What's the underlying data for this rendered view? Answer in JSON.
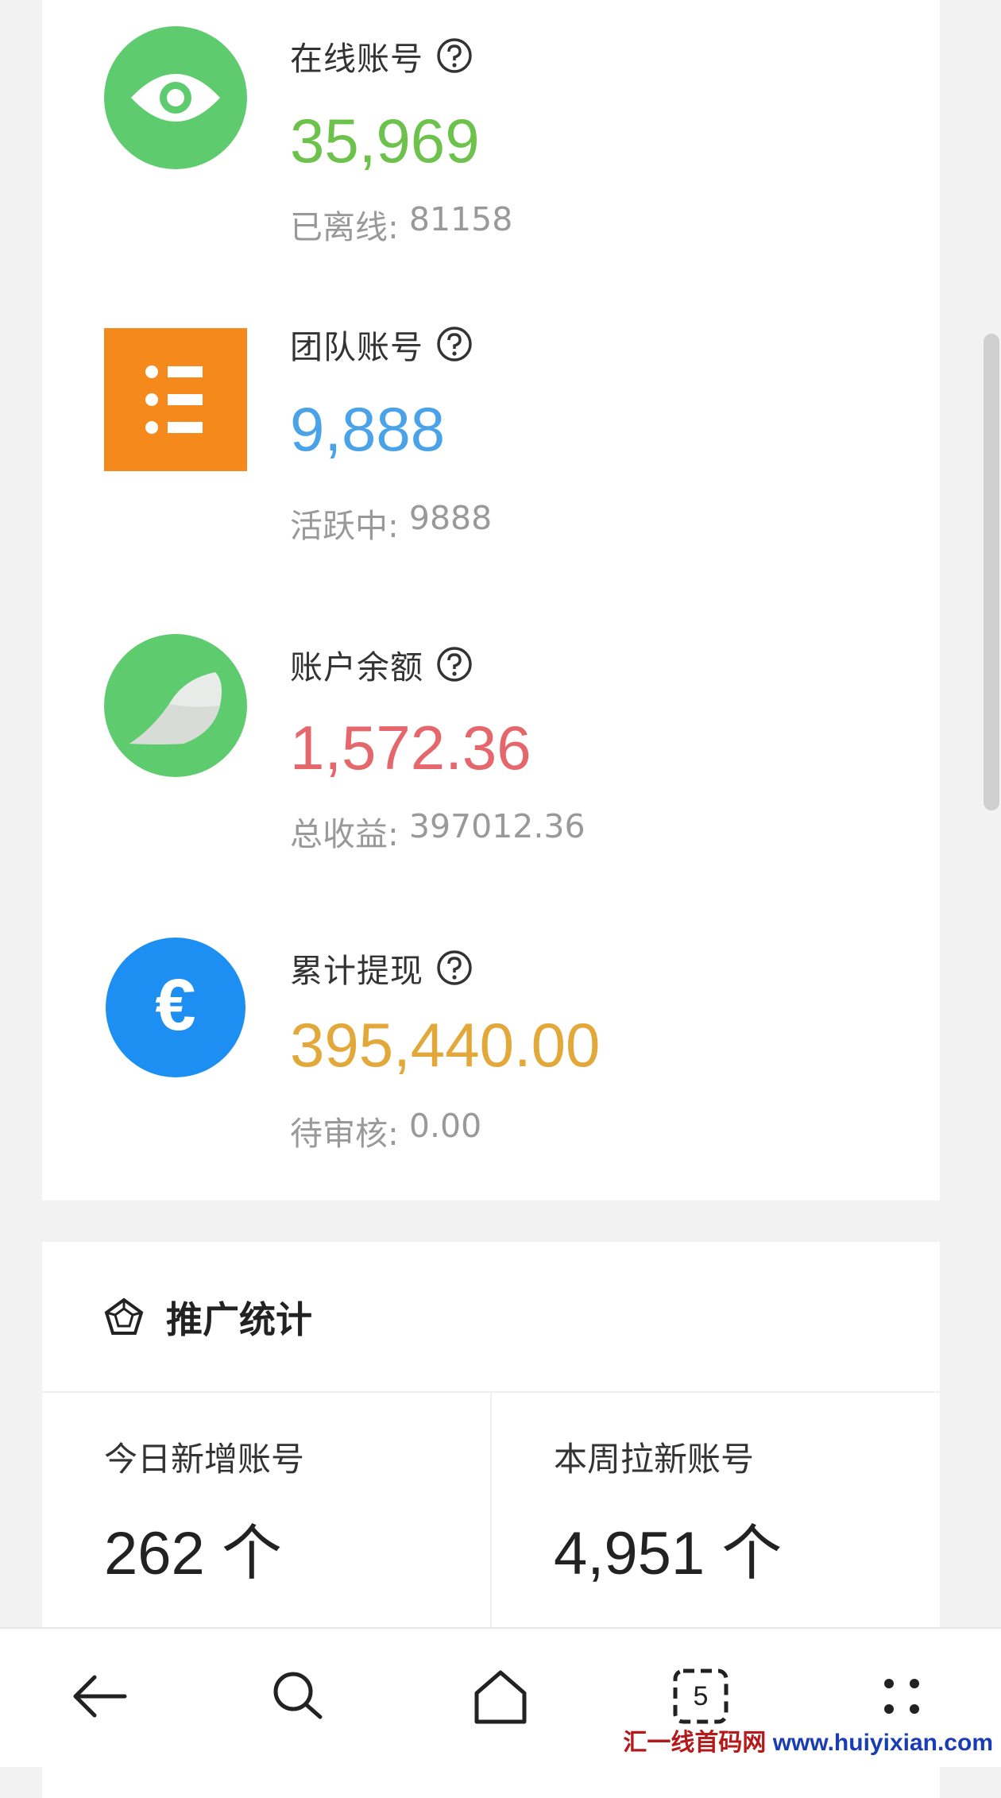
{
  "stats": [
    {
      "label": "在线账号",
      "value": "35,969",
      "sub_label": "已离线:",
      "sub_value": "81158",
      "icon": "eye-icon",
      "icon_bg": "#5ecb6e",
      "value_color": "#6cc24a"
    },
    {
      "label": "团队账号",
      "value": "9,888",
      "sub_label": "活跃中:",
      "sub_value": "9888",
      "icon": "list-icon",
      "icon_bg": "#f5891b",
      "value_color": "#4aa3e8"
    },
    {
      "label": "账户余额",
      "value": "1,572.36",
      "sub_label": "总收益:",
      "sub_value": "397012.36",
      "icon": "bird-icon",
      "icon_bg": "#5ecb6e",
      "value_color": "#e5666b"
    },
    {
      "label": "累计提现",
      "value": "395,440.00",
      "sub_label": "待审核:",
      "sub_value": "0.00",
      "icon": "euro-icon",
      "icon_bg": "#1e8ff2",
      "value_color": "#e3a83a"
    }
  ],
  "promo": {
    "title": "推广统计",
    "cells": [
      {
        "title": "今日新增账号",
        "value": "262 个"
      },
      {
        "title": "本周拉新账号",
        "value": "4,951 个"
      }
    ]
  },
  "navbar": {
    "tabs_count": "5"
  },
  "watermark": {
    "part1": "汇一线首码网",
    "part2": " www.huiyixian.com"
  }
}
